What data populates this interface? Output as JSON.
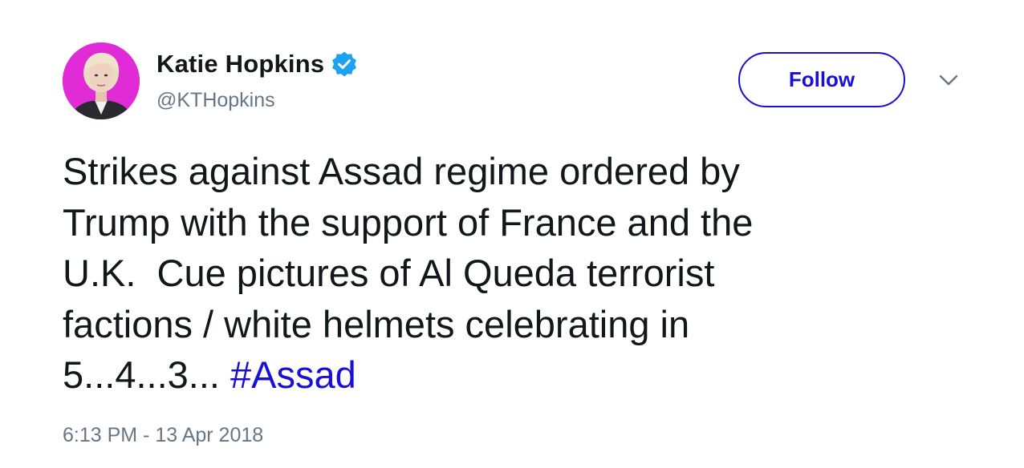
{
  "author": {
    "display_name": "Katie Hopkins",
    "handle": "@KTHopkins",
    "verified": true,
    "avatar_icon": "profile-photo",
    "avatar_bg_color": "#e02bd6"
  },
  "actions": {
    "follow_label": "Follow",
    "menu_icon": "chevron-down-icon"
  },
  "tweet": {
    "lines": [
      "Strikes against Assad regime ordered by",
      "Trump with the support of France and the",
      "U.K.  Cue pictures of Al Queda terrorist",
      "factions / white helmets celebrating in"
    ],
    "last_line_prefix": "5...4...3... ",
    "hashtag": "#Assad"
  },
  "timestamp": "6:13 PM - 13 Apr 2018",
  "colors": {
    "link": "#1a0fd4",
    "verified_badge": "#1da1f2",
    "secondary_text": "#657786",
    "primary_text": "#14171a"
  }
}
